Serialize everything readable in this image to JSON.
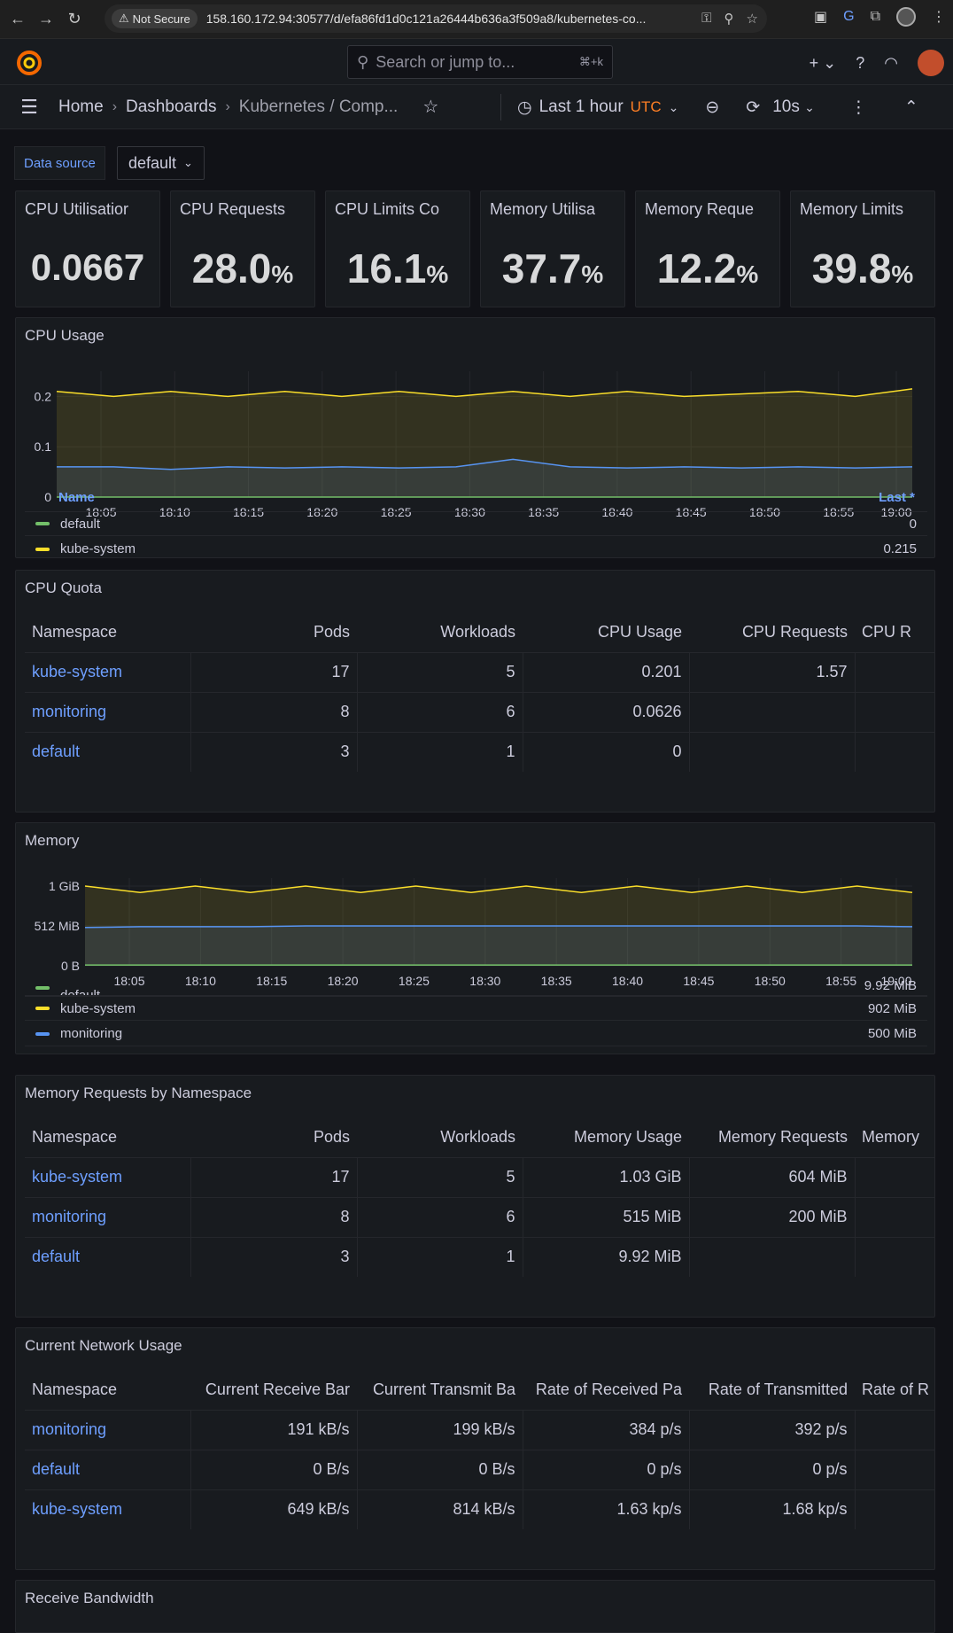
{
  "browser": {
    "security_chip": "Not Secure",
    "url": "158.160.172.94:30577/d/efa86fd1d0c121a26444b636a3f509a8/kubernetes-co..."
  },
  "topnav": {
    "search_placeholder": "Search or jump to...",
    "search_shortcut": "⌘+k"
  },
  "breadcrumb": {
    "home": "Home",
    "dashboards": "Dashboards",
    "current": "Kubernetes / Comp..."
  },
  "toolbar": {
    "time_range": "Last 1 hour",
    "timezone": "UTC",
    "refresh_interval": "10s"
  },
  "variables": {
    "datasource_label": "Data source",
    "datasource_value": "default"
  },
  "stats": [
    {
      "title": "CPU Utilisatior",
      "value": "0.0667",
      "unit": ""
    },
    {
      "title": "CPU Requests",
      "value": "28.0",
      "unit": "%"
    },
    {
      "title": "CPU Limits Co",
      "value": "16.1",
      "unit": "%"
    },
    {
      "title": "Memory Utilisa",
      "value": "37.7",
      "unit": "%"
    },
    {
      "title": "Memory Reque",
      "value": "12.2",
      "unit": "%"
    },
    {
      "title": "Memory Limits",
      "value": "39.8",
      "unit": "%"
    }
  ],
  "cpu_usage": {
    "title": "CPU Usage",
    "legend_header_name": "Name",
    "legend_header_last": "Last *",
    "legend": [
      {
        "name": "default",
        "value": "0",
        "color": "#73bf69"
      },
      {
        "name": "kube-system",
        "value": "0.215",
        "color": "#fade2a"
      }
    ]
  },
  "cpu_quota": {
    "title": "CPU Quota",
    "columns": [
      "Namespace",
      "Pods",
      "Workloads",
      "CPU Usage",
      "CPU Requests",
      "CPU R"
    ],
    "rows": [
      [
        "kube-system",
        "17",
        "5",
        "0.201",
        "1.57",
        ""
      ],
      [
        "monitoring",
        "8",
        "6",
        "0.0626",
        "",
        ""
      ],
      [
        "default",
        "3",
        "1",
        "0",
        "",
        ""
      ]
    ]
  },
  "memory": {
    "title": "Memory",
    "legend": [
      {
        "name": "default",
        "value": "9.92 MiB",
        "color": "#73bf69"
      },
      {
        "name": "kube-system",
        "value": "902 MiB",
        "color": "#fade2a"
      },
      {
        "name": "monitoring",
        "value": "500 MiB",
        "color": "#5794f2"
      }
    ]
  },
  "memory_requests": {
    "title": "Memory Requests by Namespace",
    "columns": [
      "Namespace",
      "Pods",
      "Workloads",
      "Memory Usage",
      "Memory Requests",
      "Memory"
    ],
    "rows": [
      [
        "kube-system",
        "17",
        "5",
        "1.03 GiB",
        "604 MiB",
        ""
      ],
      [
        "monitoring",
        "8",
        "6",
        "515 MiB",
        "200 MiB",
        ""
      ],
      [
        "default",
        "3",
        "1",
        "9.92 MiB",
        "",
        ""
      ]
    ]
  },
  "network": {
    "title": "Current Network Usage",
    "columns": [
      "Namespace",
      "Current Receive Bar",
      "Current Transmit Ba",
      "Rate of Received Pa",
      "Rate of Transmitted",
      "Rate of R"
    ],
    "rows": [
      [
        "monitoring",
        "191 kB/s",
        "199 kB/s",
        "384 p/s",
        "392 p/s",
        ""
      ],
      [
        "default",
        "0 B/s",
        "0 B/s",
        "0 p/s",
        "0 p/s",
        ""
      ],
      [
        "kube-system",
        "649 kB/s",
        "814 kB/s",
        "1.63 kp/s",
        "1.68 kp/s",
        ""
      ]
    ]
  },
  "receive_bandwidth": {
    "title": "Receive Bandwidth"
  },
  "chart_data": [
    {
      "type": "area",
      "title": "CPU Usage",
      "x": [
        "18:05",
        "18:10",
        "18:15",
        "18:20",
        "18:25",
        "18:30",
        "18:35",
        "18:40",
        "18:45",
        "18:50",
        "18:55",
        "19:00"
      ],
      "ylim": [
        0,
        0.25
      ],
      "yticks": [
        "0",
        "0.1",
        "0.2"
      ],
      "series": [
        {
          "name": "kube-system",
          "color": "#fade2a",
          "values": [
            0.21,
            0.2,
            0.21,
            0.2,
            0.21,
            0.2,
            0.21,
            0.2,
            0.21,
            0.2,
            0.21,
            0.2,
            0.205,
            0.21,
            0.2,
            0.215
          ]
        },
        {
          "name": "monitoring",
          "color": "#5794f2",
          "values": [
            0.06,
            0.06,
            0.055,
            0.06,
            0.058,
            0.06,
            0.058,
            0.06,
            0.075,
            0.06,
            0.058,
            0.06,
            0.058,
            0.06,
            0.058,
            0.06
          ]
        },
        {
          "name": "default",
          "color": "#73bf69",
          "values": [
            0,
            0,
            0,
            0,
            0,
            0,
            0,
            0,
            0,
            0,
            0,
            0,
            0,
            0,
            0,
            0
          ]
        }
      ]
    },
    {
      "type": "area",
      "title": "Memory",
      "x": [
        "18:05",
        "18:10",
        "18:15",
        "18:20",
        "18:25",
        "18:30",
        "18:35",
        "18:40",
        "18:45",
        "18:50",
        "18:55",
        "19:00"
      ],
      "ylim": [
        0,
        1.1
      ],
      "yticks": [
        "0 B",
        "512 MiB",
        "1 GiB"
      ],
      "series": [
        {
          "name": "kube-system",
          "color": "#fade2a",
          "values": [
            1.0,
            0.92,
            1.0,
            0.92,
            1.0,
            0.92,
            1.0,
            0.92,
            1.0,
            0.92,
            1.0,
            0.92,
            1.0,
            0.92,
            1.0,
            0.92
          ]
        },
        {
          "name": "monitoring",
          "color": "#5794f2",
          "values": [
            0.48,
            0.49,
            0.49,
            0.49,
            0.5,
            0.5,
            0.5,
            0.5,
            0.5,
            0.5,
            0.5,
            0.5,
            0.5,
            0.5,
            0.5,
            0.49
          ]
        },
        {
          "name": "default",
          "color": "#73bf69",
          "values": [
            0.01,
            0.01,
            0.01,
            0.01,
            0.01,
            0.01,
            0.01,
            0.01,
            0.01,
            0.01,
            0.01,
            0.01,
            0.01,
            0.01,
            0.01,
            0.01
          ]
        }
      ]
    }
  ]
}
